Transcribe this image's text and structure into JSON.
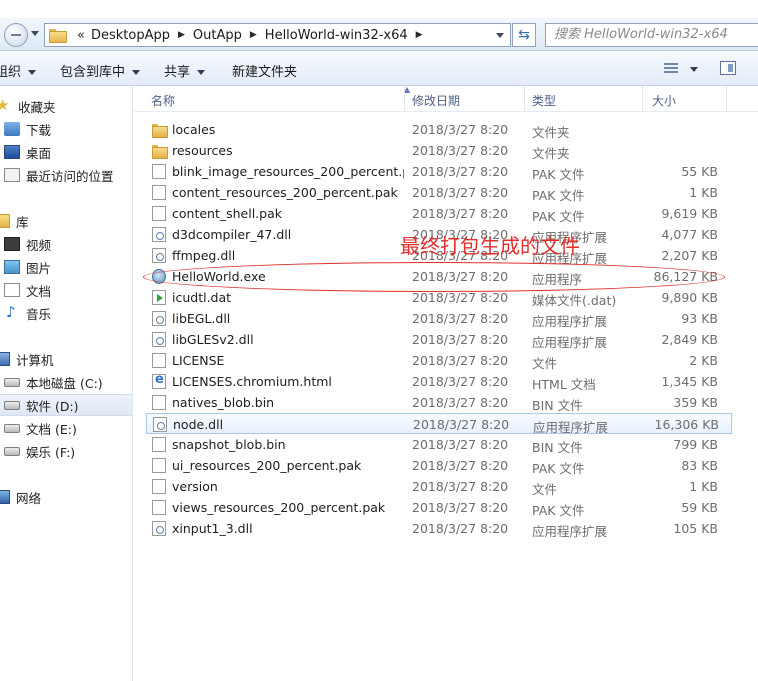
{
  "address": {
    "chevron": "«",
    "crumbs": [
      "DesktopApp",
      "OutApp",
      "HelloWorld-win32-x64"
    ],
    "search_placeholder": "搜索 HelloWorld-win32-x64"
  },
  "toolbar": {
    "organize": "组织",
    "include_library": "包含到库中",
    "share": "共享",
    "new_folder": "新建文件夹"
  },
  "sidebar": {
    "favorites": "收藏夹",
    "downloads": "下载",
    "desktop": "桌面",
    "recent": "最近访问的位置",
    "libraries": "库",
    "videos": "视频",
    "pictures": "图片",
    "documents": "文档",
    "music": "音乐",
    "computer": "计算机",
    "drive_c": "本地磁盘 (C:)",
    "drive_d": "软件 (D:)",
    "drive_e": "文档 (E:)",
    "drive_f": "娱乐 (F:)",
    "network": "网络"
  },
  "columns": {
    "name": "名称",
    "date": "修改日期",
    "type": "类型",
    "size": "大小"
  },
  "files": [
    {
      "name": "locales",
      "date": "2018/3/27 8:20",
      "type": "文件夹",
      "size": "",
      "icon": "folder-icon"
    },
    {
      "name": "resources",
      "date": "2018/3/27 8:20",
      "type": "文件夹",
      "size": "",
      "icon": "folder-icon"
    },
    {
      "name": "blink_image_resources_200_percent.p...",
      "date": "2018/3/27 8:20",
      "type": "PAK 文件",
      "size": "55 KB",
      "icon": "file-icon"
    },
    {
      "name": "content_resources_200_percent.pak",
      "date": "2018/3/27 8:20",
      "type": "PAK 文件",
      "size": "1 KB",
      "icon": "file-icon"
    },
    {
      "name": "content_shell.pak",
      "date": "2018/3/27 8:20",
      "type": "PAK 文件",
      "size": "9,619 KB",
      "icon": "file-icon"
    },
    {
      "name": "d3dcompiler_47.dll",
      "date": "2018/3/27 8:20",
      "type": "应用程序扩展",
      "size": "4,077 KB",
      "icon": "dll-icon"
    },
    {
      "name": "ffmpeg.dll",
      "date": "2018/3/27 8:20",
      "type": "应用程序扩展",
      "size": "2,207 KB",
      "icon": "dll-icon"
    },
    {
      "name": "HelloWorld.exe",
      "date": "2018/3/27 8:20",
      "type": "应用程序",
      "size": "86,127 KB",
      "icon": "exe-icon"
    },
    {
      "name": "icudtl.dat",
      "date": "2018/3/27 8:20",
      "type": "媒体文件(.dat)",
      "size": "9,890 KB",
      "icon": "media-icon"
    },
    {
      "name": "libEGL.dll",
      "date": "2018/3/27 8:20",
      "type": "应用程序扩展",
      "size": "93 KB",
      "icon": "dll-icon"
    },
    {
      "name": "libGLESv2.dll",
      "date": "2018/3/27 8:20",
      "type": "应用程序扩展",
      "size": "2,849 KB",
      "icon": "dll-icon"
    },
    {
      "name": "LICENSE",
      "date": "2018/3/27 8:20",
      "type": "文件",
      "size": "2 KB",
      "icon": "file-icon"
    },
    {
      "name": "LICENSES.chromium.html",
      "date": "2018/3/27 8:20",
      "type": "HTML 文档",
      "size": "1,345 KB",
      "icon": "html-icon"
    },
    {
      "name": "natives_blob.bin",
      "date": "2018/3/27 8:20",
      "type": "BIN 文件",
      "size": "359 KB",
      "icon": "file-icon"
    },
    {
      "name": "node.dll",
      "date": "2018/3/27 8:20",
      "type": "应用程序扩展",
      "size": "16,306 KB",
      "icon": "dll-icon"
    },
    {
      "name": "snapshot_blob.bin",
      "date": "2018/3/27 8:20",
      "type": "BIN 文件",
      "size": "799 KB",
      "icon": "file-icon"
    },
    {
      "name": "ui_resources_200_percent.pak",
      "date": "2018/3/27 8:20",
      "type": "PAK 文件",
      "size": "83 KB",
      "icon": "file-icon"
    },
    {
      "name": "version",
      "date": "2018/3/27 8:20",
      "type": "文件",
      "size": "1 KB",
      "icon": "file-icon"
    },
    {
      "name": "views_resources_200_percent.pak",
      "date": "2018/3/27 8:20",
      "type": "PAK 文件",
      "size": "59 KB",
      "icon": "file-icon"
    },
    {
      "name": "xinput1_3.dll",
      "date": "2018/3/27 8:20",
      "type": "应用程序扩展",
      "size": "105 KB",
      "icon": "dll-icon"
    }
  ],
  "selected_file": "node.dll",
  "annotation": {
    "text": "最终打包生成的文件",
    "color": "#e0302b"
  }
}
